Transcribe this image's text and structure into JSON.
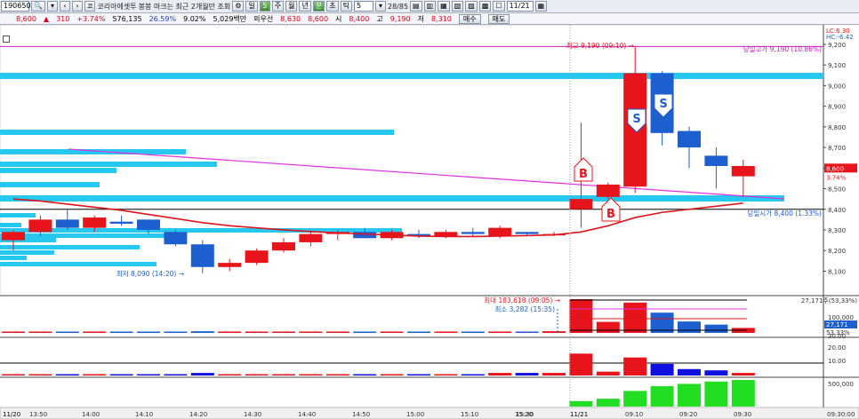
{
  "toolbar": {
    "code": "190650",
    "name": "코리아에셋투",
    "search_hint": "봉봉 마크는 최근 2개월만 조회",
    "periods": [
      "일",
      "5",
      "주",
      "월",
      "년",
      "분",
      "초",
      "틱"
    ],
    "period_count": "5",
    "count": "28/85",
    "date": "11/21"
  },
  "info": {
    "price": "8,600",
    "change_arrow": "▲",
    "change": "310",
    "change_rate": "+3.74%",
    "volume": "576,135",
    "turnover_ratio": "26.59%",
    "ratio2": "9.02%",
    "trade_value": "5,029백만",
    "prices_label": "외우선",
    "p1": "8,630",
    "p2": "8,600",
    "open_label": "시",
    "open": "8,400",
    "high_label": "고",
    "high": "9,190",
    "low_label": "저",
    "low": "8,310",
    "buy_label": "매수",
    "sell_label": "매도"
  },
  "colors": {
    "up": "#e8141c",
    "down": "#1e5fd0",
    "ma": "#e0141c",
    "trend": "#e030e0",
    "hbar": "#27c8f0",
    "volup": "#22dd22"
  },
  "chart_data": {
    "type": "candlestick",
    "price_axis": [
      "9,200",
      "9,100",
      "9,000",
      "8,900",
      "8,800",
      "8,700",
      "8,600",
      "8,500",
      "8,400",
      "8,300",
      "8,200",
      "8,100"
    ],
    "axis_top": "LC:6.30",
    "axis_top2": "HC:-6.42",
    "current_price": "8,600",
    "current_rate": "3.74%",
    "high_label": "최고 9,190 (09:10)",
    "low_label": "최저 8,090 (14:20)",
    "day_high_label": "당일고가 9,190 (10.86%)",
    "day_open_label": "당일시가 8,400 (1.33%)",
    "markers": [
      {
        "type": "B",
        "x": "09:05"
      },
      {
        "type": "B",
        "x": "09:05"
      },
      {
        "type": "S",
        "x": "09:10"
      },
      {
        "type": "S",
        "x": "09:15"
      }
    ],
    "candles": [
      {
        "o": 8250,
        "h": 8300,
        "l": 8200,
        "c": 8290
      },
      {
        "o": 8290,
        "h": 8370,
        "l": 8270,
        "c": 8350
      },
      {
        "o": 8350,
        "h": 8400,
        "l": 8300,
        "c": 8310
      },
      {
        "o": 8310,
        "h": 8370,
        "l": 8290,
        "c": 8360
      },
      {
        "o": 8340,
        "h": 8370,
        "l": 8320,
        "c": 8330
      },
      {
        "o": 8350,
        "h": 8350,
        "l": 8280,
        "c": 8300
      },
      {
        "o": 8290,
        "h": 8300,
        "l": 8220,
        "c": 8230
      },
      {
        "o": 8230,
        "h": 8250,
        "l": 8090,
        "c": 8120
      },
      {
        "o": 8120,
        "h": 8160,
        "l": 8100,
        "c": 8140
      },
      {
        "o": 8140,
        "h": 8210,
        "l": 8130,
        "c": 8200
      },
      {
        "o": 8200,
        "h": 8260,
        "l": 8190,
        "c": 8240
      },
      {
        "o": 8240,
        "h": 8290,
        "l": 8220,
        "c": 8280
      },
      {
        "o": 8280,
        "h": 8300,
        "l": 8250,
        "c": 8290
      },
      {
        "o": 8290,
        "h": 8310,
        "l": 8260,
        "c": 8260
      },
      {
        "o": 8260,
        "h": 8300,
        "l": 8250,
        "c": 8290
      },
      {
        "o": 8280,
        "h": 8300,
        "l": 8260,
        "c": 8270
      },
      {
        "o": 8270,
        "h": 8300,
        "l": 8260,
        "c": 8290
      },
      {
        "o": 8290,
        "h": 8310,
        "l": 8270,
        "c": 8280
      },
      {
        "o": 8270,
        "h": 8320,
        "l": 8260,
        "c": 8310
      },
      {
        "o": 8290,
        "h": 8290,
        "l": 8270,
        "c": 8280
      },
      {
        "o": 8280,
        "h": 8290,
        "l": 8270,
        "c": 8280
      },
      {
        "o": 8400,
        "h": 8820,
        "l": 8310,
        "c": 8450
      },
      {
        "o": 8460,
        "h": 8530,
        "l": 8450,
        "c": 8520
      },
      {
        "o": 8510,
        "h": 9190,
        "l": 8480,
        "c": 9060
      },
      {
        "o": 9060,
        "h": 9070,
        "l": 8710,
        "c": 8770
      },
      {
        "o": 8780,
        "h": 8800,
        "l": 8600,
        "c": 8700
      },
      {
        "o": 8660,
        "h": 8700,
        "l": 8500,
        "c": 8610
      },
      {
        "o": 8560,
        "h": 8640,
        "l": 8460,
        "c": 8610
      }
    ],
    "time_labels": [
      "11/20",
      "13:50",
      "14:00",
      "14:10",
      "14:20",
      "14:30",
      "14:40",
      "14:50",
      "15:00",
      "15:10",
      "15:20",
      "15:30",
      "11/21",
      "09:10",
      "09:20",
      "09:30",
      "09:30:00"
    ],
    "volume": {
      "max_label": "최대 183,618 (09:05)",
      "min_label": "최소 3,282 (15:35)",
      "top_label": "27,171주(53,33%)",
      "axis": [
        "100,000"
      ],
      "current": "27,171",
      "current2": "53.33%",
      "values": [
        6000,
        5000,
        5000,
        4000,
        6000,
        6000,
        7000,
        9000,
        5000,
        6000,
        6000,
        5000,
        5000,
        5000,
        5000,
        5000,
        6000,
        6000,
        7000,
        7000,
        9000,
        183618,
        60000,
        165000,
        110000,
        62000,
        45000,
        27171
      ]
    },
    "osc": {
      "axis": [
        "30.00",
        "20.00",
        "10.00"
      ],
      "values": [
        1,
        1,
        1,
        1,
        1,
        1,
        1,
        2,
        1,
        1,
        1,
        1,
        1,
        1,
        1,
        1,
        1,
        1,
        2,
        2,
        2,
        17,
        3,
        14,
        9,
        5,
        4,
        2
      ]
    },
    "obv": {
      "axis": [
        "500,000"
      ],
      "values": [
        0,
        0,
        0,
        0,
        0,
        0,
        0,
        0,
        0,
        0,
        0,
        0,
        0,
        0,
        0,
        0,
        0,
        0,
        0,
        0,
        0,
        70000,
        100000,
        200000,
        260000,
        290000,
        320000,
        340000
      ]
    }
  }
}
